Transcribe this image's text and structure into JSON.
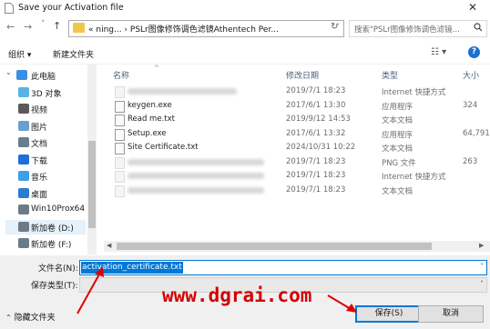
{
  "window": {
    "title": "Save your Activation file",
    "close_glyph": "✕"
  },
  "nav": {
    "back_glyph": "←",
    "forward_glyph": "→",
    "recent_glyph": "˅",
    "up_glyph": "↑",
    "address_text": "« ning... › PSLr图像修饰调色滤镜Athentech Per...",
    "address_chevron": "˅",
    "refresh_glyph": "↻",
    "search_placeholder": "搜索\"PSLr图像修饰调色滤镜...",
    "search_icon": "search-icon"
  },
  "toolbar": {
    "organize_label": "组织 ▾",
    "new_folder_label": "新建文件夹",
    "view_glyph": "☷ ▾",
    "help_glyph": "?"
  },
  "sidebar": {
    "items": [
      {
        "label": "此电脑",
        "icon": "computer-icon",
        "color": "#3a8ee6"
      },
      {
        "label": "3D 对象",
        "icon": "3d-objects-icon",
        "color": "#57b2e6"
      },
      {
        "label": "视频",
        "icon": "videos-icon",
        "color": "#5a5a5a"
      },
      {
        "label": "图片",
        "icon": "pictures-icon",
        "color": "#6a9fd0"
      },
      {
        "label": "文档",
        "icon": "documents-icon",
        "color": "#6a7c90"
      },
      {
        "label": "下载",
        "icon": "downloads-icon",
        "color": "#1e6fd6"
      },
      {
        "label": "音乐",
        "icon": "music-icon",
        "color": "#3aa0e8"
      },
      {
        "label": "桌面",
        "icon": "desktop-icon",
        "color": "#2b7bd0"
      },
      {
        "label": "Win10Prox64 (C",
        "icon": "drive-icon",
        "color": "#6c7a88"
      },
      {
        "label": "新加卷 (D:)",
        "icon": "drive-icon",
        "color": "#6c7a88"
      },
      {
        "label": "新加卷 (F:)",
        "icon": "drive-icon",
        "color": "#6c7a88"
      }
    ],
    "selected_index": 9
  },
  "filelist": {
    "columns": {
      "name": "名称",
      "date": "修改日期",
      "type": "类型",
      "size": "大小"
    },
    "sort_glyph": "^",
    "rows": [
      {
        "name": "",
        "date": "2019/7/1 18:23",
        "type": "Internet 快捷方式",
        "size": "",
        "blurred": true
      },
      {
        "name": "keygen.exe",
        "date": "2017/6/1 13:30",
        "type": "应用程序",
        "size": "324"
      },
      {
        "name": "Read me.txt",
        "date": "2019/9/12 14:53",
        "type": "文本文档",
        "size": ""
      },
      {
        "name": "Setup.exe",
        "date": "2017/6/1 13:32",
        "type": "应用程序",
        "size": "64,791"
      },
      {
        "name": "Site Certificate.txt",
        "date": "2024/10/31 10:22",
        "type": "文本文档",
        "size": ""
      },
      {
        "name": "",
        "date": "2019/7/1 18:23",
        "type": "PNG 文件",
        "size": "263",
        "blurred": true
      },
      {
        "name": "",
        "date": "2019/7/1 18:23",
        "type": "Internet 快捷方式",
        "size": "",
        "blurred": true
      },
      {
        "name": "",
        "date": "2019/7/1 18:23",
        "type": "文本文档",
        "size": "",
        "blurred": true
      }
    ]
  },
  "form": {
    "filename_label": "文件名(N):",
    "filename_value": "activation_certificate.txt",
    "filetype_label": "保存类型(T):",
    "filetype_value": "",
    "hide_folders_label": "隐藏文件夹",
    "save_label": "保存(S)",
    "cancel_label": "取消"
  },
  "watermark": {
    "text": "www.dgrai.com",
    "color": "#d40000"
  }
}
